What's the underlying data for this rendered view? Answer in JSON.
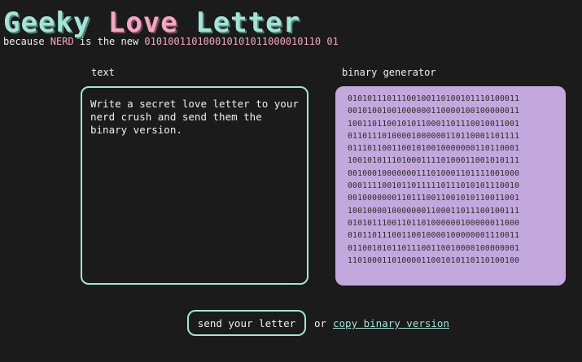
{
  "header": {
    "title_word1": "Geeky",
    "title_word2": "Love",
    "title_word3": "Letter",
    "subtitle_pre": "because ",
    "subtitle_highlight": "NERD",
    "subtitle_mid": " is the new ",
    "subtitle_binary": "010100110100010101011000010110 01"
  },
  "text_panel": {
    "label": "text",
    "value": "Write a secret love letter to your nerd crush and send them the binary version."
  },
  "binary_panel": {
    "label": "binary generator",
    "lines": [
      "01010111011100100110100101110100011",
      "00101001001000000110000100100000011",
      "10011011001010110001101110010011001",
      "01101110100001000000110110001101111",
      "01110110011001010010000000110110001",
      "10010101110100011110100011001010111",
      "00100010000000111010001101111001000",
      "00011110010110111110111010101110010",
      "00100000001101110011001010110011001",
      "10010000100000001100011011100100111",
      "01010111001101101000000100000011000",
      "01011011100110010000100000001110011",
      "01100101011011100110010000100000001",
      "11010001101000011001010110110100100"
    ]
  },
  "actions": {
    "send_label": "send your letter",
    "or_label": "or",
    "copy_label": "copy binary version"
  },
  "colors": {
    "background": "#1b1b1b",
    "accent_mint": "#a6e3d7",
    "accent_pink": "#f4a7c3",
    "binary_bg": "#c3a8dd"
  }
}
